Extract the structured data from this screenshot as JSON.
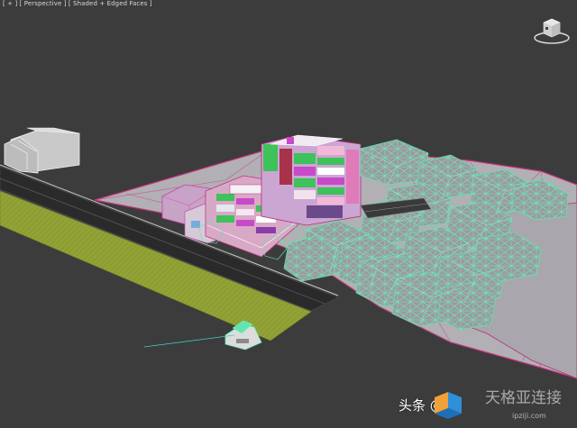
{
  "viewport": {
    "label": "[ + ] [ Perspective ] [ Shaded + Edged Faces ]",
    "background": "#3c3c3c",
    "colors": {
      "ground": "#b4b1b6",
      "ground_edge": "#c0307a",
      "road": "#2b2b2b",
      "grass": "#8a9a32",
      "wire": "#5fe6b0",
      "building_green": "#3ec25a",
      "building_magenta": "#c84ac8",
      "building_pink": "#f0a0c0"
    }
  },
  "viewcube": {
    "icon": "viewcube-icon"
  },
  "watermark": {
    "brand": "头条 @",
    "logo_icon": "toutiao-logo-icon",
    "site_text": "天格亚连接",
    "url": "ipziji.com"
  }
}
